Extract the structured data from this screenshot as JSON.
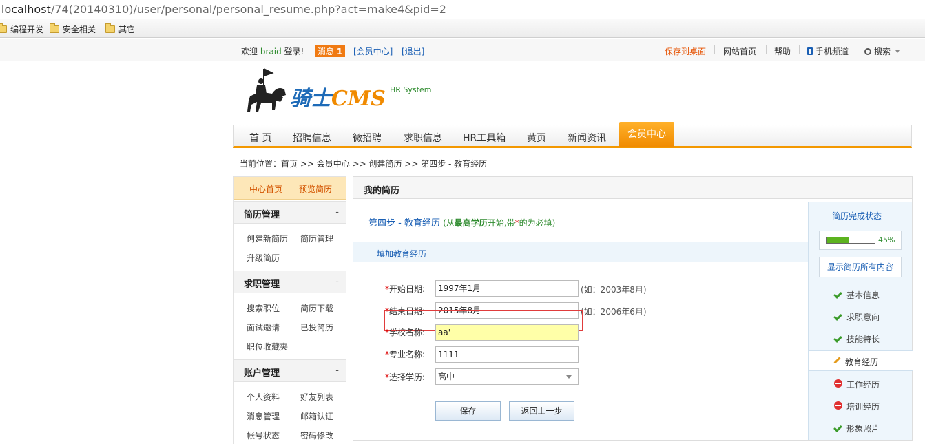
{
  "browser": {
    "url_host": "localhost",
    "url_path": "/74(20140310)/user/personal/personal_resume.php?act=make4&pid=2",
    "bookmarks": [
      {
        "label": "编程开发"
      },
      {
        "label": "安全相关"
      },
      {
        "label": "其它"
      }
    ]
  },
  "topbar": {
    "welcome": "欢迎",
    "username": "braid",
    "login_suffix": "登录!",
    "message_label": "消息",
    "message_count": "1",
    "member_center": "[会员中心]",
    "logout": "[退出]",
    "save_desktop": "保存到桌面",
    "site_home": "网站首页",
    "help": "帮助",
    "mobile": "手机频道",
    "search": "搜索"
  },
  "logo": {
    "name_cn": "骑士",
    "name_en": "CMS",
    "tagline": "HR System"
  },
  "nav": {
    "items": [
      "首 页",
      "招聘信息",
      "微招聘",
      "求职信息",
      "HR工具箱",
      "黄页",
      "新闻资讯"
    ],
    "active": "会员中心"
  },
  "breadcrumb": "当前位置：首页 >> 会员中心 >> 创建简历 >> 第四步 - 教育经历",
  "sidebar": {
    "home": "中心首页",
    "preview": "预览简历",
    "sections": [
      {
        "title": "简历管理",
        "toggle": "-",
        "items": [
          "创建新简历",
          "简历管理",
          "升级简历"
        ]
      },
      {
        "title": "求职管理",
        "toggle": "-",
        "items": [
          "搜索职位",
          "简历下载",
          "面试邀请",
          "已投简历",
          "职位收藏夹"
        ]
      },
      {
        "title": "账户管理",
        "toggle": "-",
        "items": [
          "个人资料",
          "好友列表",
          "消息管理",
          "邮箱认证",
          "帐号状态",
          "密码修改"
        ]
      }
    ]
  },
  "main": {
    "title": "我的简历",
    "step_title": "第四步 - 教育经历",
    "step_note_open": "(从",
    "step_note_bold": "最高学历",
    "step_note_mid": "开始,带",
    "step_note_star": "*",
    "step_note_close": "的为必填)",
    "add_section": "填加教育经历",
    "fields": {
      "start_label": "开始日期:",
      "start_value": "1997年1月",
      "start_hint": "(如：2003年8月)",
      "end_label": "结束日期:",
      "end_value": "2015年8月",
      "end_hint": "(如：2006年6月)",
      "school_label": "学校名称:",
      "school_value": "aa'",
      "major_label": "专业名称:",
      "major_value": "1111",
      "degree_label": "选择学历:",
      "degree_value": "高中"
    },
    "save_button": "保存",
    "back_button": "返回上一步"
  },
  "progress": {
    "title": "简历完成状态",
    "percent": 45,
    "percent_label": "45%",
    "show_all": "显示简历所有内容",
    "steps": [
      {
        "label": "基本信息",
        "status": "done"
      },
      {
        "label": "求职意向",
        "status": "done"
      },
      {
        "label": "技能特长",
        "status": "done"
      },
      {
        "label": "教育经历",
        "status": "current"
      },
      {
        "label": "工作经历",
        "status": "missing"
      },
      {
        "label": "培训经历",
        "status": "missing"
      },
      {
        "label": "形象照片",
        "status": "done"
      }
    ]
  },
  "colors": {
    "accent_orange": "#f39800",
    "link_blue": "#1a5fb4",
    "highlight_yellow": "#ffffa8",
    "error_red": "#e03c3c",
    "progress_green": "#5cb31f"
  }
}
